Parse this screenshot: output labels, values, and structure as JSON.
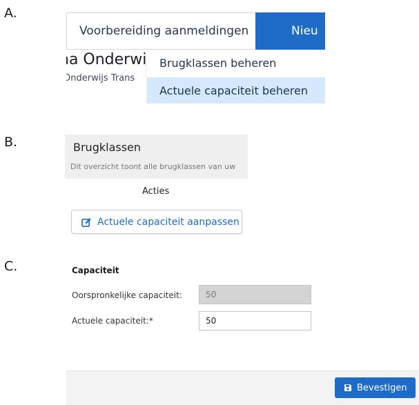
{
  "steps": {
    "a": "A.",
    "b": "B.",
    "c": "C."
  },
  "panel_a": {
    "tabs": [
      {
        "label": "Voorbereiding aanmeldingen"
      },
      {
        "label": "Nieu"
      }
    ],
    "background_title": "na Onderwi",
    "background_subtitle": "Onderwijs Trans",
    "dropdown": [
      {
        "label": "Brugklassen beheren"
      },
      {
        "label": "Actuele capaciteit beheren"
      }
    ]
  },
  "panel_b": {
    "title": "Brugklassen",
    "description": "Dit overzicht toont alle brugklassen van uw",
    "column_header": "Acties",
    "button_label": "Actuele capaciteit aanpassen",
    "icons": {
      "button": "edit-icon"
    }
  },
  "panel_c": {
    "heading": "Capaciteit",
    "fields": [
      {
        "label": "Oorspronkelijke capaciteit:",
        "value": "50"
      },
      {
        "label": "Actuele capaciteit:*",
        "value": "50"
      }
    ],
    "confirm_label": "Bevestigen",
    "icons": {
      "confirm": "save-icon"
    }
  },
  "colors": {
    "accent": "#1e6cc8",
    "highlight": "#d6e8fb",
    "header_bg": "#efefef",
    "disabled_bg": "#d4d4d4"
  }
}
